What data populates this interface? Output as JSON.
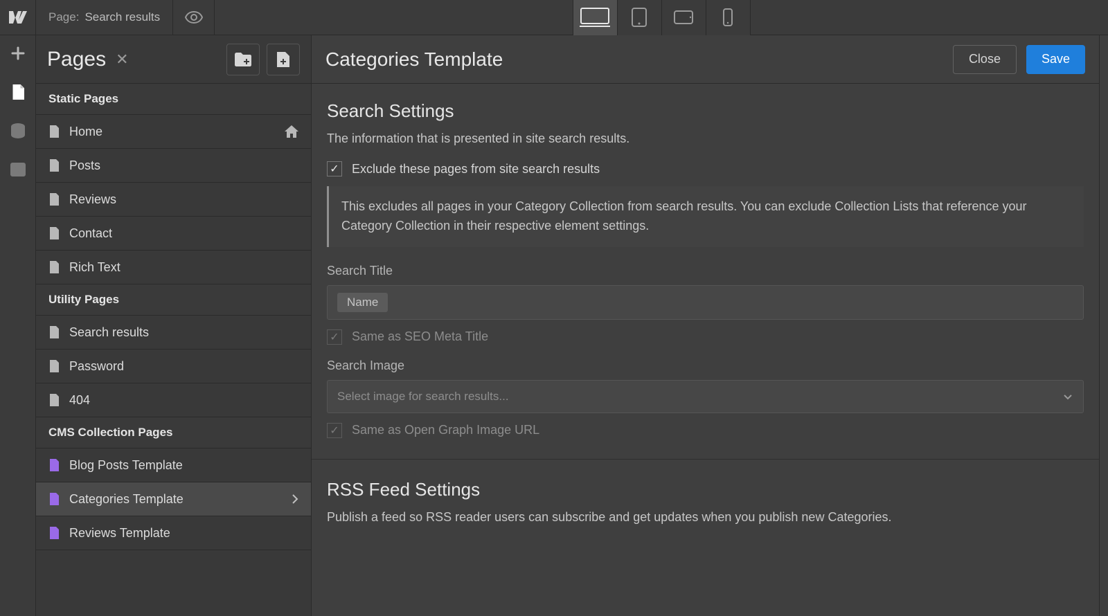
{
  "topbar": {
    "page_key": "Page:",
    "page_value": "Search results"
  },
  "panel": {
    "title": "Pages",
    "sections": [
      {
        "title": "Static Pages",
        "items": [
          {
            "label": "Home",
            "home": true
          },
          {
            "label": "Posts"
          },
          {
            "label": "Reviews"
          },
          {
            "label": "Contact"
          },
          {
            "label": "Rich Text"
          }
        ]
      },
      {
        "title": "Utility Pages",
        "items": [
          {
            "label": "Search results"
          },
          {
            "label": "Password"
          },
          {
            "label": "404"
          }
        ]
      },
      {
        "title": "CMS Collection Pages",
        "cms": true,
        "items": [
          {
            "label": "Blog Posts Template"
          },
          {
            "label": "Categories Template",
            "selected": true
          },
          {
            "label": "Reviews Template"
          }
        ]
      }
    ]
  },
  "settings": {
    "title": "Categories Template",
    "close": "Close",
    "save": "Save",
    "search_settings": {
      "heading": "Search Settings",
      "sub": "The information that is presented in site search results.",
      "exclude_label": "Exclude these pages from site search results",
      "callout": "This excludes all pages in your Category Collection from search results. You can exclude Collection Lists that reference your Category Collection in their respective element settings.",
      "title_label": "Search Title",
      "title_chip": "Name",
      "same_seo": "Same as SEO Meta Title",
      "image_label": "Search Image",
      "image_placeholder": "Select image for search results...",
      "same_og": "Same as Open Graph Image URL"
    },
    "rss": {
      "heading": "RSS Feed Settings",
      "sub": "Publish a feed so RSS reader users can subscribe and get updates when you publish new Categories."
    }
  }
}
